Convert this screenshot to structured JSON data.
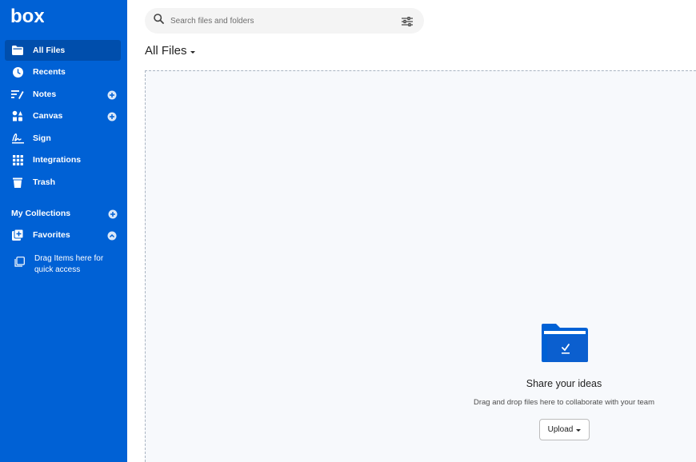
{
  "brand": {
    "logo_text": "box",
    "accent": "#0061d5"
  },
  "sidebar": {
    "items": [
      {
        "label": "All Files",
        "icon": "folder-icon",
        "active": true
      },
      {
        "label": "Recents",
        "icon": "clock-icon"
      },
      {
        "label": "Notes",
        "icon": "notes-icon",
        "has_add": true
      },
      {
        "label": "Canvas",
        "icon": "canvas-icon",
        "has_add": true
      },
      {
        "label": "Sign",
        "icon": "signature-icon"
      },
      {
        "label": "Integrations",
        "icon": "grid-icon"
      },
      {
        "label": "Trash",
        "icon": "trash-icon"
      }
    ],
    "collections_label": "My Collections",
    "favorites_label": "Favorites",
    "quick_access_text": "Drag Items here for quick access"
  },
  "search": {
    "placeholder": "Search files and folders"
  },
  "main": {
    "title": "All Files",
    "empty_title": "Share your ideas",
    "empty_subtitle": "Drag and drop files here to collaborate with your team",
    "upload_label": "Upload"
  }
}
